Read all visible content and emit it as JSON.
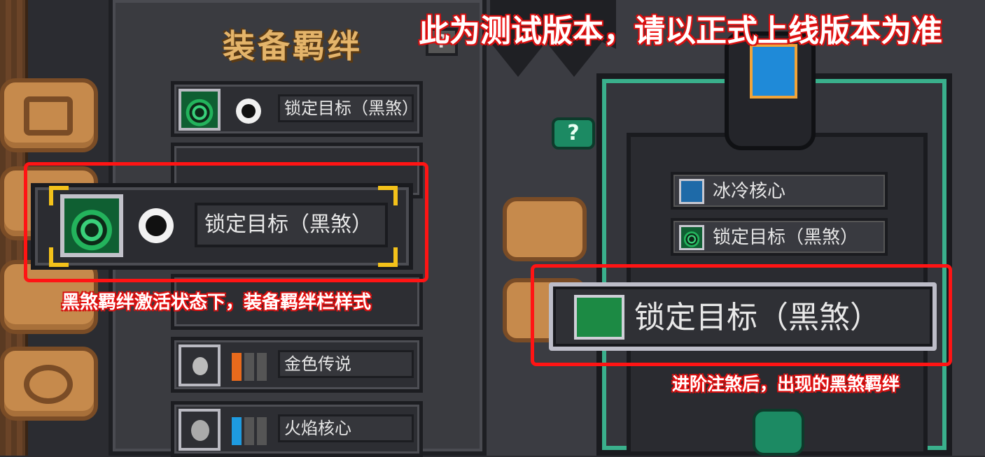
{
  "notice": "此为测试版本，请以正式上线版本为准",
  "left_panel": {
    "title": "装备羁绊",
    "help_label": "?",
    "rows": [
      {
        "label": "锁定目标（黑煞）"
      },
      {
        "label": "金色传说"
      },
      {
        "label": "火焰核心"
      }
    ],
    "active_bar": {
      "label": "锁定目标（黑煞）"
    },
    "caption": "黑煞羁绊激活状态下，装备羁绊栏样式"
  },
  "right_panel": {
    "help_label": "?",
    "bond_list": [
      {
        "label": "冰冷核心"
      },
      {
        "label": "锁定目标（黑煞）"
      }
    ],
    "large_bar": {
      "label": "锁定目标（黑煞）"
    },
    "caption": "进阶注煞后，出现的黑煞羁绊"
  },
  "colors": {
    "highlight_red": "#ff1414",
    "accent_teal": "#3ab08c",
    "corner_gold": "#f4c21a",
    "title_gold": "#e4b46a"
  }
}
